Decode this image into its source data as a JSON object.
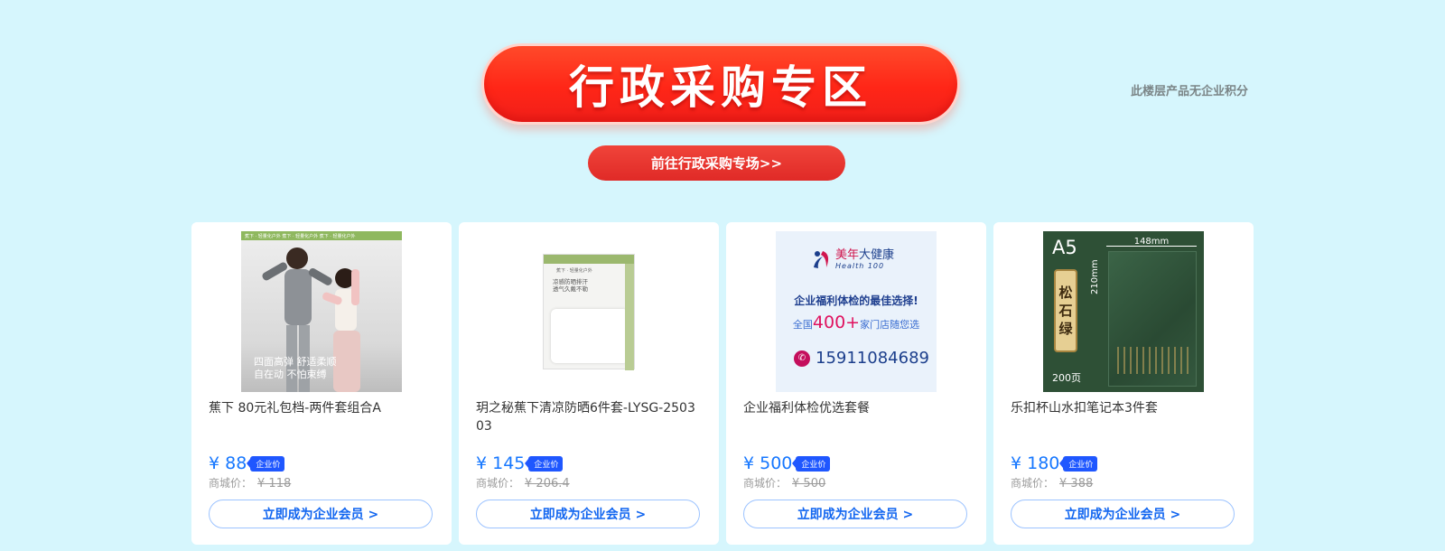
{
  "header": {
    "banner_title": "行政采购专区",
    "floor_note": "此楼层产品无企业积分",
    "promo_button_label": "前往行政采购专场>>"
  },
  "colors": {
    "background": "#d6f6fd",
    "banner_red": "#ff2617",
    "price_blue": "#1677ff",
    "badge_blue": "#1f57ff"
  },
  "products": [
    {
      "title": "蕉下 80元礼包档-两件套组合A",
      "price": "¥ 88",
      "badge": "企业价",
      "mall_label": "商城价：",
      "mall_price": "¥ 118",
      "button_label": "立即成为企业会员 >",
      "image": {
        "caption_line1": "四面高弹 舒适柔顺",
        "caption_line2": "自在动 不怕束缚",
        "stripe_text": "蕉下 · 轻量化户外    蕉下 · 轻量化户外    蕉下 · 轻量化户外"
      }
    },
    {
      "title": "玥之秘蕉下清凉防晒6件套-LYSG-250303",
      "price": "¥ 145",
      "badge": "企业价",
      "mall_label": "商城价：",
      "mall_price": "¥ 206.4",
      "button_label": "立即成为企业会员 >",
      "image": {
        "brand_text": "蕉下 · 轻量化户外",
        "pack_line1": "凉感防晒排汗",
        "pack_line2": "透气久戴不勒"
      }
    },
    {
      "title": "企业福利体检优选套餐",
      "price": "¥ 500",
      "badge": "企业价",
      "mall_label": "商城价：",
      "mall_price": "¥ 500",
      "button_label": "立即成为企业会员 >",
      "image": {
        "brand_cn_red": "美年",
        "brand_cn_blue": "大健康",
        "brand_en": "Health 100",
        "slogan": "企业福利体检的最佳选择!",
        "count_prefix": "全国",
        "count_big": "400+",
        "count_suffix": "家门店随您选",
        "phone": "15911084689"
      }
    },
    {
      "title": "乐扣杯山水扣笔记本3件套",
      "price": "¥ 180",
      "badge": "企业价",
      "mall_label": "商城价：",
      "mall_price": "¥ 388",
      "button_label": "立即成为企业会员 >",
      "image": {
        "size_label": "A5",
        "width_label": "148mm",
        "height_label": "210mm",
        "scroll_text_1": "松",
        "scroll_text_2": "石",
        "scroll_text_3": "绿",
        "pages_label": "200页"
      }
    }
  ]
}
